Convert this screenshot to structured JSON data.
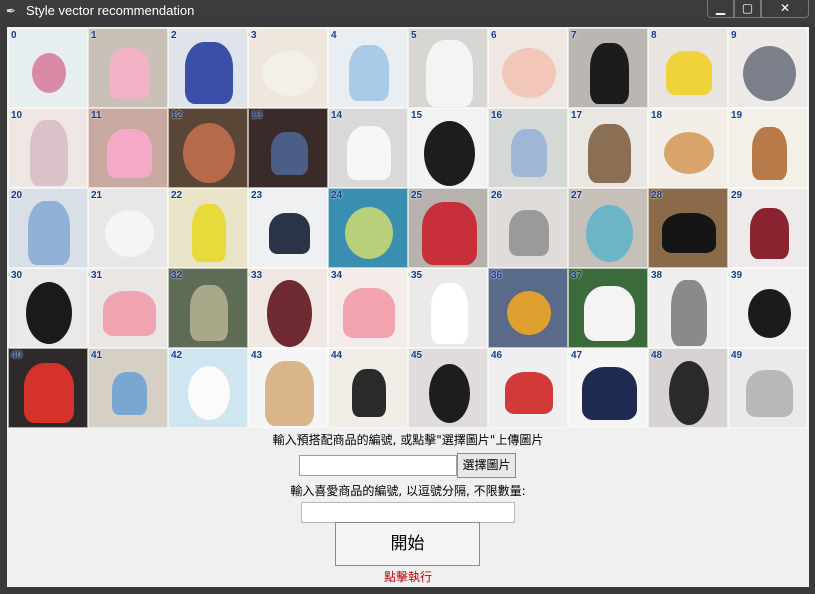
{
  "window": {
    "title": "Style vector recommendation",
    "icon": "feather-icon",
    "min_label": "▁",
    "max_label": "▢",
    "close_label": "✕"
  },
  "grid": {
    "items": [
      {
        "num": "0",
        "bg": "#e7eef0",
        "fg": "#d98aa6"
      },
      {
        "num": "1",
        "bg": "#c9c1b8",
        "fg": "#f2b3c6"
      },
      {
        "num": "2",
        "bg": "#dfe3ea",
        "fg": "#3b4fa8"
      },
      {
        "num": "3",
        "bg": "#efe6dd",
        "fg": "#f3efe9"
      },
      {
        "num": "4",
        "bg": "#e9eef2",
        "fg": "#a9cbe8"
      },
      {
        "num": "5",
        "bg": "#d8d6d2",
        "fg": "#f4f4f4"
      },
      {
        "num": "6",
        "bg": "#efe8e2",
        "fg": "#f2c6b8"
      },
      {
        "num": "7",
        "bg": "#b9b6b4",
        "fg": "#1c1c1c"
      },
      {
        "num": "8",
        "bg": "#e8e4df",
        "fg": "#f0d23a"
      },
      {
        "num": "9",
        "bg": "#ece9e6",
        "fg": "#7a7f8a"
      },
      {
        "num": "10",
        "bg": "#efe7e4",
        "fg": "#d9c3c9"
      },
      {
        "num": "11",
        "bg": "#c7a9a0",
        "fg": "#f5a9c8"
      },
      {
        "num": "12",
        "bg": "#5a4636",
        "fg": "#b66a4a"
      },
      {
        "num": "13",
        "bg": "#3b2a2a",
        "fg": "#4b5f86"
      },
      {
        "num": "14",
        "bg": "#d9d9d9",
        "fg": "#f7f7f7"
      },
      {
        "num": "15",
        "bg": "#f2f2f2",
        "fg": "#1d1d1d"
      },
      {
        "num": "16",
        "bg": "#d4d9d6",
        "fg": "#9fb7d6"
      },
      {
        "num": "17",
        "bg": "#eae7e2",
        "fg": "#8b6f55"
      },
      {
        "num": "18",
        "bg": "#f3efe8",
        "fg": "#d9a46b"
      },
      {
        "num": "19",
        "bg": "#f3f0ea",
        "fg": "#b97a4a"
      },
      {
        "num": "20",
        "bg": "#d8dfe6",
        "fg": "#8fb1d6"
      },
      {
        "num": "21",
        "bg": "#e7e7e7",
        "fg": "#f5f5f5"
      },
      {
        "num": "22",
        "bg": "#e9e3c8",
        "fg": "#e8da3a"
      },
      {
        "num": "23",
        "bg": "#eef0f2",
        "fg": "#2a3348"
      },
      {
        "num": "24",
        "bg": "#3a8fb0",
        "fg": "#b8d07a"
      },
      {
        "num": "25",
        "bg": "#b7b2ad",
        "fg": "#c7303a"
      },
      {
        "num": "26",
        "bg": "#dfdcda",
        "fg": "#9a9a9a"
      },
      {
        "num": "27",
        "bg": "#c7c0b8",
        "fg": "#6bb5c6"
      },
      {
        "num": "28",
        "bg": "#8a6a4a",
        "fg": "#151515"
      },
      {
        "num": "29",
        "bg": "#eeeaea",
        "fg": "#8a2330"
      },
      {
        "num": "30",
        "bg": "#e9e9e9",
        "fg": "#1a1a1a"
      },
      {
        "num": "31",
        "bg": "#eae6e3",
        "fg": "#f0a4b0"
      },
      {
        "num": "32",
        "bg": "#5e6b55",
        "fg": "#a9a98a"
      },
      {
        "num": "33",
        "bg": "#efe8e2",
        "fg": "#6e2a30"
      },
      {
        "num": "34",
        "bg": "#f4ece8",
        "fg": "#f2a3ad"
      },
      {
        "num": "35",
        "bg": "#eceae8",
        "fg": "#ffffff"
      },
      {
        "num": "36",
        "bg": "#5a6b8a",
        "fg": "#e0a030"
      },
      {
        "num": "37",
        "bg": "#3b6b3a",
        "fg": "#f4f4f4"
      },
      {
        "num": "38",
        "bg": "#efefef",
        "fg": "#8a8a8a"
      },
      {
        "num": "39",
        "bg": "#f0f0f0",
        "fg": "#1b1b1b"
      },
      {
        "num": "40",
        "bg": "#2e2a2a",
        "fg": "#d4322a"
      },
      {
        "num": "41",
        "bg": "#d6cfc6",
        "fg": "#7aa7d2"
      },
      {
        "num": "42",
        "bg": "#cfe6f0",
        "fg": "#fbfbfb"
      },
      {
        "num": "43",
        "bg": "#f5f5f5",
        "fg": "#d9b68a"
      },
      {
        "num": "44",
        "bg": "#f0ece6",
        "fg": "#2a2a2a"
      },
      {
        "num": "45",
        "bg": "#e0dcdc",
        "fg": "#1d1d1d"
      },
      {
        "num": "46",
        "bg": "#efefef",
        "fg": "#d23a3a"
      },
      {
        "num": "47",
        "bg": "#f5f5f5",
        "fg": "#1f2a50"
      },
      {
        "num": "48",
        "bg": "#d8d3d3",
        "fg": "#2a2a2a"
      },
      {
        "num": "49",
        "bg": "#eaeaea",
        "fg": "#b8b8b8"
      }
    ]
  },
  "form": {
    "instruction_upload": "輸入預搭配商品的編號, 或點擊\"選擇圖片\"上傳圖片",
    "upload_value": "",
    "choose_button": "選擇圖片",
    "instruction_favorites": "輸入喜愛商品的編號, 以逗號分隔, 不限數量:",
    "favorites_value": "",
    "start_button": "開始",
    "status_text": "點擊執行",
    "status_color": "#c00000"
  }
}
